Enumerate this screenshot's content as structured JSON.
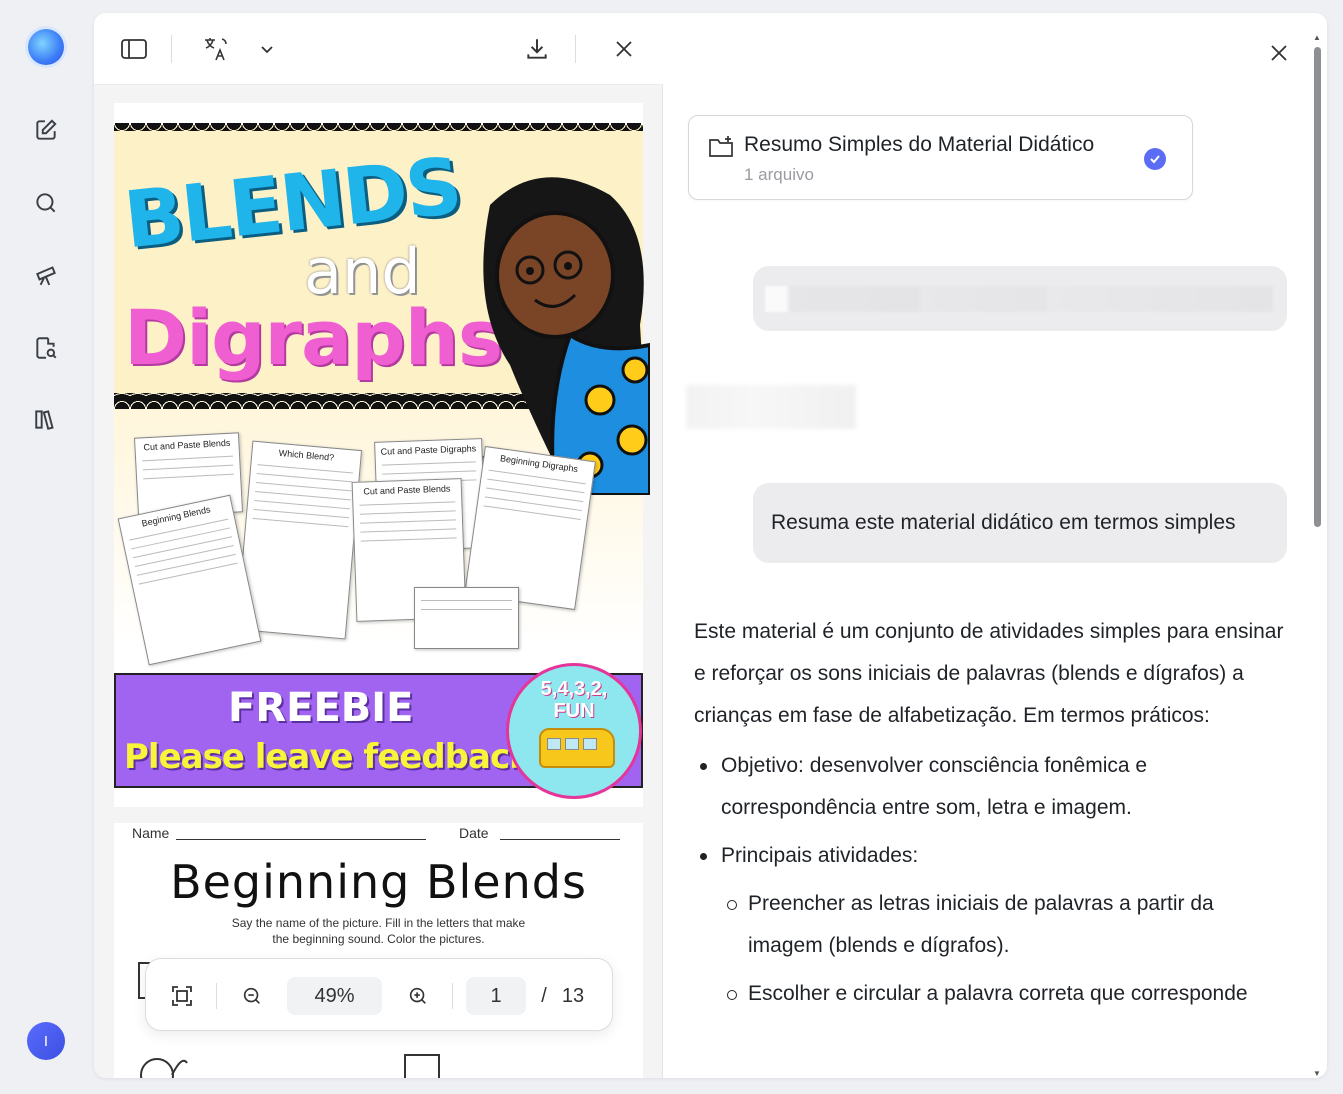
{
  "rail": {
    "items": [
      "new-chat",
      "search",
      "discover",
      "document-search",
      "library"
    ],
    "avatar_letter": "I"
  },
  "viewer": {
    "zoom": "49%",
    "page_current": "1",
    "page_separator": "/",
    "page_total": "13",
    "cover": {
      "title_blends": "BLENDS",
      "title_and": "and",
      "title_digraphs": "Digraphs",
      "freebie": "FREEBIE",
      "feedback": "Please leave feedback",
      "badge": "5,4,3,2,\nFUN",
      "worksheets": [
        "Cut and Paste Blends",
        "Which Blend?",
        "Cut and Paste Digraphs",
        "Beginning Digraphs",
        "Beginning Blends",
        "Cut and Paste Blends"
      ]
    },
    "page2": {
      "name_label": "Name",
      "date_label": "Date",
      "title": "Beginning Blends",
      "subtitle": "Say the name of the picture. Fill in the letters that make the beginning sound. Color the pictures."
    }
  },
  "chat": {
    "file_card": {
      "title": "Resumo Simples do Material Didático",
      "subtitle": "1 arquivo"
    },
    "user_message": "Resuma este material didático em termos simples",
    "answer_intro": "Este material é um conjunto de atividades simples para ensinar e reforçar os sons iniciais de palavras (blends e dígrafos) a crianças em fase de alfabetização. Em termos práticos:",
    "bullets": [
      {
        "text": "Objetivo: desenvolver consciência fonêmica e correspondência entre som, letra e imagem."
      },
      {
        "text": "Principais atividades:"
      }
    ],
    "sub_bullets": [
      "Preencher as letras iniciais de palavras a partir da imagem (blends e dígrafos).",
      "Escolher e circular a palavra correta que corresponde"
    ]
  },
  "colors": {
    "accent": "#5b6cf5",
    "bubble": "#ececee",
    "cover_blue": "#1fb4ea",
    "cover_pink": "#ef5fd1",
    "banner_purple": "#a064f0"
  }
}
